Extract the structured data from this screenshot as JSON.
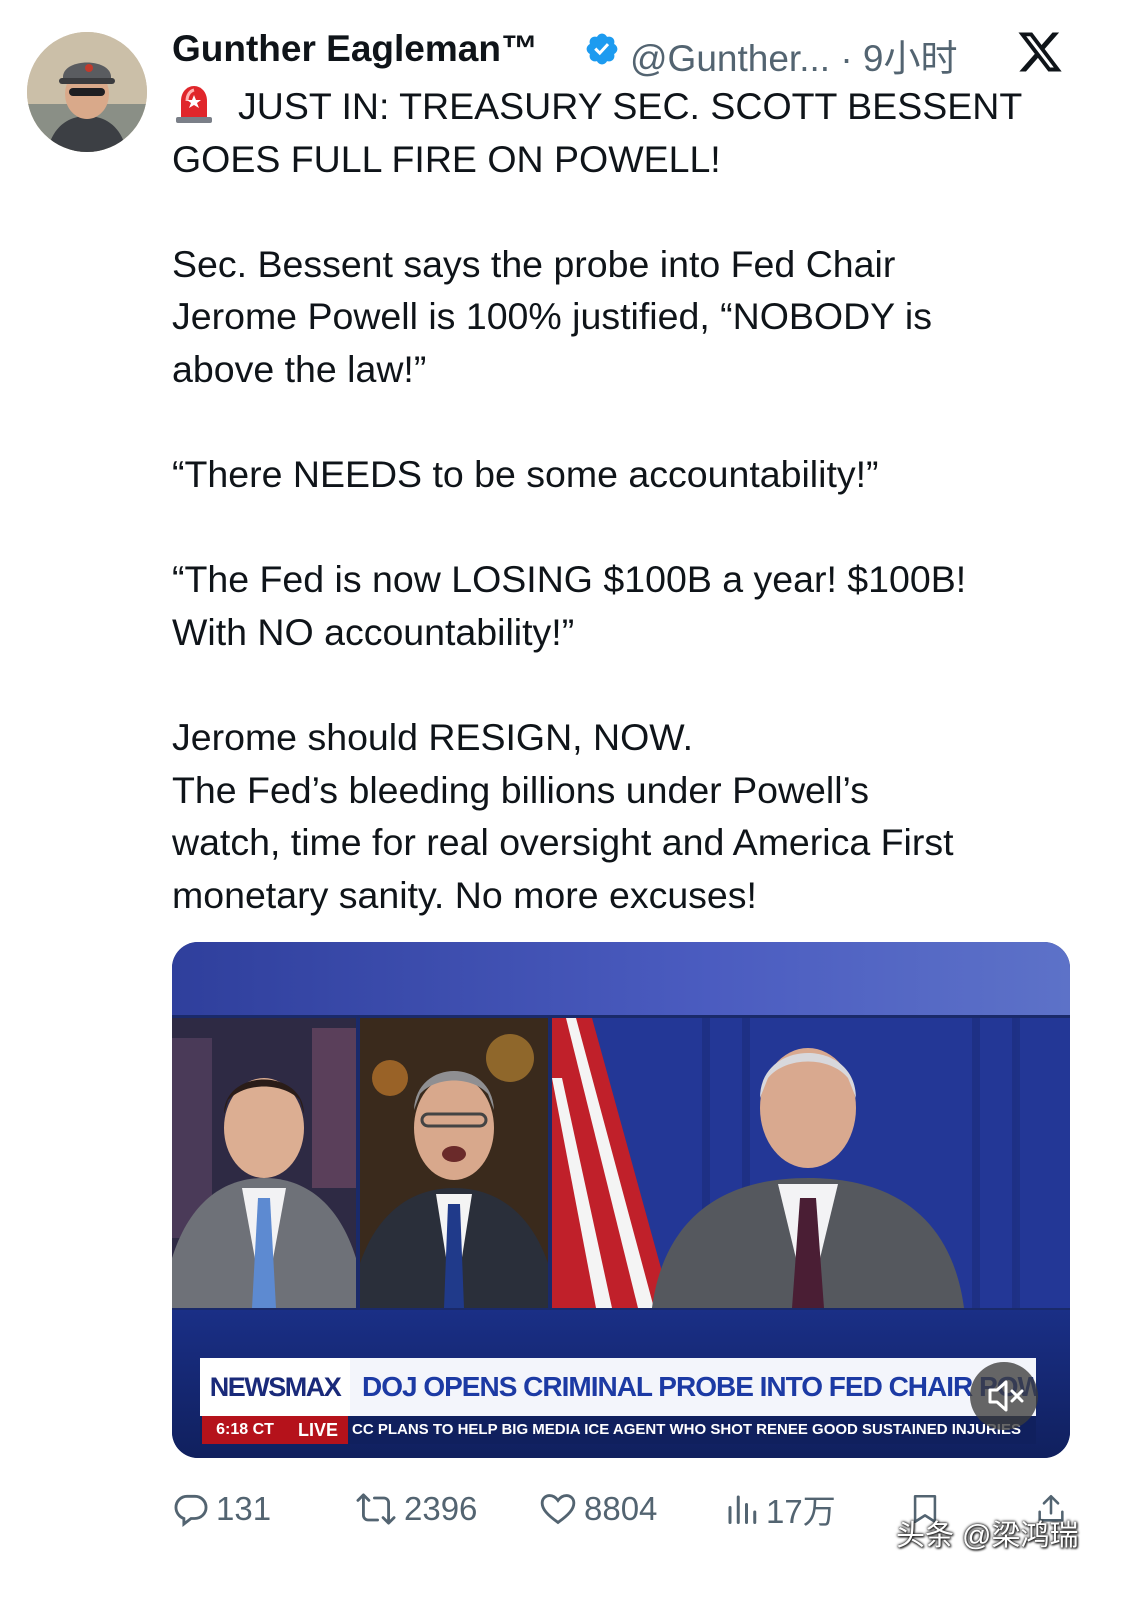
{
  "tweet": {
    "author_name": "Gunther Eagleman™",
    "handle_time": "@Gunther... · 9小时",
    "text_lines": {
      "l1": "JUST IN: TREASURY SEC. SCOTT BESSENT",
      "l2": "GOES FULL FIRE ON POWELL!",
      "p2": "Sec. Bessent says the probe into Fed Chair\nJerome Powell is 100% justified, “NOBODY is\nabove the law!”",
      "p3": "“There NEEDS to be some accountability!”",
      "p4": "“The Fed is now LOSING $100B a year! $100B!\nWith NO accountability!”",
      "p5": "Jerome should RESIGN, NOW.\nThe Fed’s bleeding billions under Powell’s\nwatch, time for real oversight and America First\nmonetary sanity. No more excuses!"
    }
  },
  "media": {
    "network": "NEWSMAX",
    "headline": "DOJ OPENS CRIMINAL PROBE INTO FED CHAIR POWELL",
    "clock": "6:18 CT",
    "live": "LIVE",
    "crawl": "CC PLANS TO HELP BIG MEDIA      ICE AGENT WHO SHOT RENEE GOOD SUSTAINED INJURIES"
  },
  "actions": {
    "replies": "131",
    "retweets": "2396",
    "likes": "8804",
    "views": "17万"
  },
  "icons": {
    "verified": "verified-badge-icon",
    "platform": "x-logo-icon",
    "siren": "siren-emoji-icon",
    "reply": "reply-icon",
    "retweet": "retweet-icon",
    "like": "heart-icon",
    "views": "views-icon",
    "bookmark": "bookmark-icon",
    "share": "share-icon",
    "mute": "mute-icon"
  },
  "watermark": "头条 @梁鸿瑞",
  "colors": {
    "verified_blue": "#1d9bf0",
    "secondary_text": "#536471",
    "newsmax_blue": "#1c3aa4",
    "live_red": "#b5121b"
  }
}
